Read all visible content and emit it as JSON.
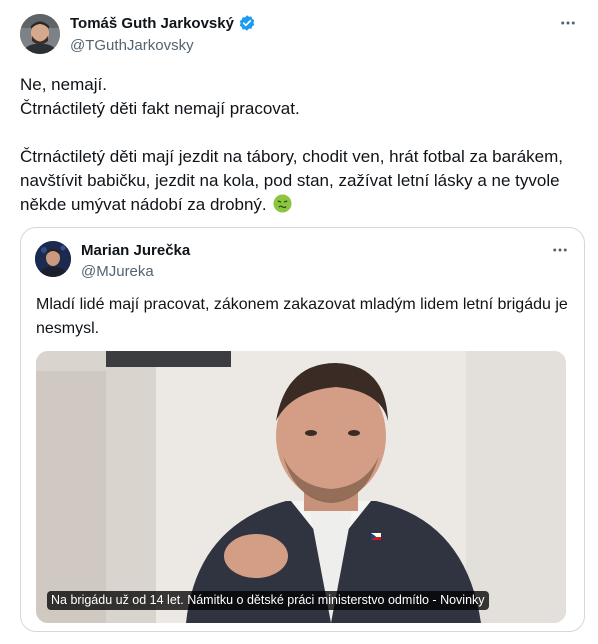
{
  "post": {
    "author_name": "Tomáš Guth Jarkovský",
    "author_handle": "@TGuthJarkovsky",
    "verified_color": "#1d9bf0",
    "more_icon": "more-horizontal-icon",
    "text_line1": "Ne, nemají.",
    "text_line2": "Čtrnáctiletý děti fakt nemají pracovat.",
    "text_para2": "Čtrnáctiletý děti mají jezdit na tábory, chodit ven, hrát fotbal za barákem, navštívit babičku, jezdit na kola, pod stan, zažívat letní lásky a ne tyvole někde umývat nádobí za drobný.",
    "emoji": "nauseated-face-icon"
  },
  "quoted": {
    "author_name": "Marian Jurečka",
    "author_handle": "@MJureka",
    "text": "Mladí lidé mají pracovat, zákonem zakazovat mladým lidem letní brigádu je nesmysl.",
    "media_caption": "Na brigádu už od 14 let. Námitku o dětské práci ministerstvo odmítlo - Novinky"
  },
  "colors": {
    "text": "#0f1419",
    "secondary": "#536471",
    "border": "#cfd9de",
    "accent": "#1d9bf0"
  }
}
